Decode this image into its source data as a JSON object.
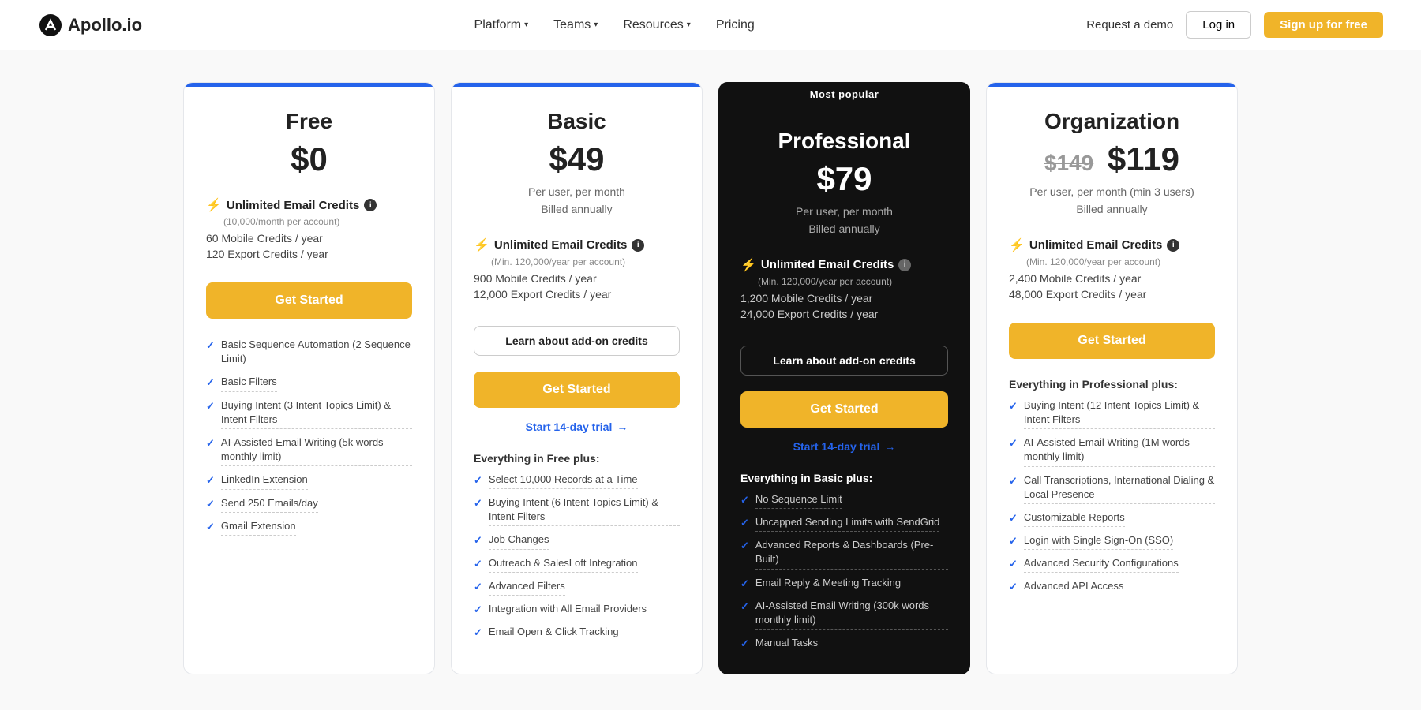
{
  "nav": {
    "logo_text": "Apollo.io",
    "links": [
      {
        "label": "Platform",
        "has_dropdown": true
      },
      {
        "label": "Teams",
        "has_dropdown": true
      },
      {
        "label": "Resources",
        "has_dropdown": true
      },
      {
        "label": "Pricing",
        "has_dropdown": false
      }
    ],
    "request_demo": "Request a demo",
    "login": "Log in",
    "signup": "Sign up for free"
  },
  "plans": [
    {
      "id": "free",
      "name": "Free",
      "price": "$0",
      "price_old": null,
      "billing": null,
      "is_popular": false,
      "email_credits": "Unlimited Email Credits",
      "email_credits_sub": "(10,000/month per account)",
      "mobile_credits": "60 Mobile Credits / year",
      "export_credits": "120 Export Credits / year",
      "show_learn_credits": false,
      "cta": "Get Started",
      "trial_text": null,
      "features_header": null,
      "features": [
        "Basic Sequence Automation (2 Sequence Limit)",
        "Basic Filters",
        "Buying Intent (3 Intent Topics Limit) & Intent Filters",
        "AI-Assisted Email Writing (5k words monthly limit)",
        "LinkedIn Extension",
        "Send 250 Emails/day",
        "Gmail Extension"
      ]
    },
    {
      "id": "basic",
      "name": "Basic",
      "price": "$49",
      "price_old": null,
      "billing": "Per user, per month\nBilled annually",
      "is_popular": false,
      "email_credits": "Unlimited Email Credits",
      "email_credits_sub": "(Min. 120,000/year per account)",
      "mobile_credits": "900 Mobile Credits / year",
      "export_credits": "12,000 Export Credits / year",
      "show_learn_credits": true,
      "learn_credits_label": "Learn about add-on credits",
      "cta": "Get Started",
      "trial_text": "Start 14-day trial",
      "features_header": "Everything in Free plus:",
      "features": [
        "Select 10,000 Records at a Time",
        "Buying Intent (6 Intent Topics Limit) & Intent Filters",
        "Job Changes",
        "Outreach & SalesLoft Integration",
        "Advanced Filters",
        "Integration with All Email Providers",
        "Email Open & Click Tracking"
      ]
    },
    {
      "id": "professional",
      "name": "Professional",
      "price": "$79",
      "price_old": null,
      "billing": "Per user, per month\nBilled annually",
      "is_popular": true,
      "email_credits": "Unlimited Email Credits",
      "email_credits_sub": "(Min. 120,000/year per account)",
      "mobile_credits": "1,200 Mobile Credits / year",
      "export_credits": "24,000 Export Credits / year",
      "show_learn_credits": true,
      "learn_credits_label": "Learn about add-on credits",
      "cta": "Get Started",
      "trial_text": "Start 14-day trial",
      "features_header": "Everything in Basic plus:",
      "features": [
        "No Sequence Limit",
        "Uncapped Sending Limits with SendGrid",
        "Advanced Reports & Dashboards (Pre-Built)",
        "Email Reply & Meeting Tracking",
        "AI-Assisted Email Writing (300k words monthly limit)",
        "Manual Tasks"
      ]
    },
    {
      "id": "organization",
      "name": "Organization",
      "price": "$119",
      "price_old": "$149",
      "billing": "Per user, per month (min 3 users)\nBilled annually",
      "is_popular": false,
      "email_credits": "Unlimited Email Credits",
      "email_credits_sub": "(Min. 120,000/year per account)",
      "mobile_credits": "2,400 Mobile Credits / year",
      "export_credits": "48,000 Export Credits / year",
      "show_learn_credits": false,
      "cta": "Get Started",
      "trial_text": null,
      "features_header": "Everything in Professional plus:",
      "features": [
        "Buying Intent (12 Intent Topics Limit) & Intent Filters",
        "AI-Assisted Email Writing (1M words monthly limit)",
        "Call Transcriptions, International Dialing & Local Presence",
        "Customizable Reports",
        "Login with Single Sign-On (SSO)",
        "Advanced Security Configurations",
        "Advanced API Access"
      ]
    }
  ],
  "popular_badge": "Most popular"
}
